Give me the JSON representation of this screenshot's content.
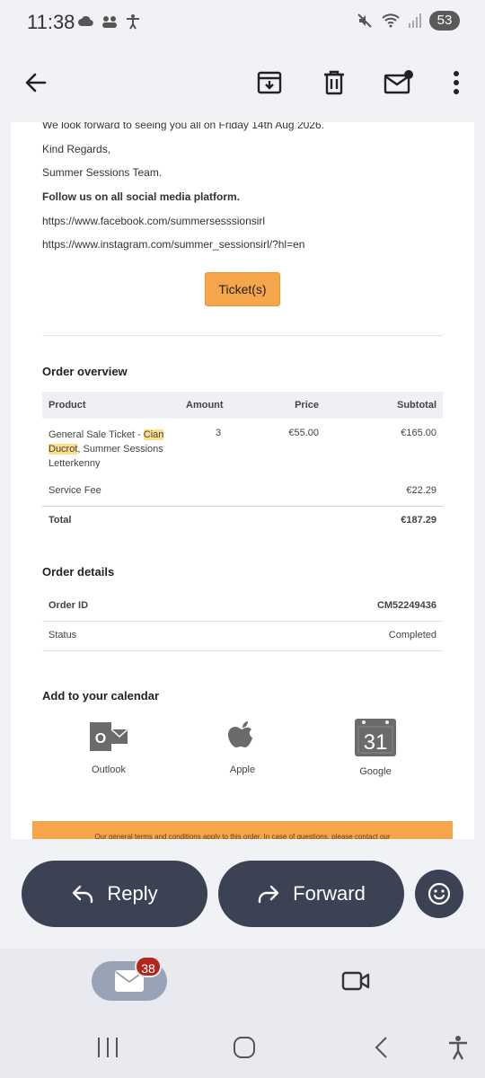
{
  "status_bar": {
    "time": "11:38",
    "battery": "53"
  },
  "email": {
    "lines": {
      "look_forward": "We look forward to seeing you all on Friday 14th Aug 2026.",
      "regards": "Kind Regards,",
      "team": "Summer Sessions Team.",
      "follow": "Follow us on all social media platform.",
      "facebook": "https://www.facebook.com/summersesssionsirl",
      "instagram": "https://www.instagram.com/summer_sessionsirl/?hl=en"
    },
    "ticket_button": "Ticket(s)",
    "order_overview": {
      "title": "Order overview",
      "headers": {
        "product": "Product",
        "amount": "Amount",
        "price": "Price",
        "subtotal": "Subtotal"
      },
      "item": {
        "product_prefix": "General Sale Ticket - ",
        "product_name_1": "Cian",
        "product_name_2": "Ducrot",
        "product_suffix": ", Summer Sessions",
        "product_line3": "Letterkenny",
        "amount": "3",
        "price": "€55.00",
        "subtotal": "€165.00"
      },
      "service_fee": {
        "label": "Service Fee",
        "value": "€22.29"
      },
      "total": {
        "label": "Total",
        "value": "€187.29"
      }
    },
    "order_details": {
      "title": "Order details",
      "order_id": {
        "label": "Order ID",
        "value": "CM52249436"
      },
      "status": {
        "label": "Status",
        "value": "Completed"
      }
    },
    "calendar": {
      "title": "Add to your calendar",
      "items": [
        {
          "label": "Outlook",
          "icon": "outlook-icon"
        },
        {
          "label": "Apple",
          "icon": "apple-icon"
        },
        {
          "label": "Google",
          "icon": "google-calendar-icon",
          "day": "31"
        }
      ]
    },
    "footer_text": "Our general terms and conditions apply to this order. In case of questions, please contact our"
  },
  "actions": {
    "reply": "Reply",
    "forward": "Forward"
  },
  "bottom_nav": {
    "mail_badge": "38"
  },
  "colors": {
    "accent_orange": "#f5a54a",
    "action_dark": "#3a4254",
    "badge_red": "#b3261e"
  }
}
